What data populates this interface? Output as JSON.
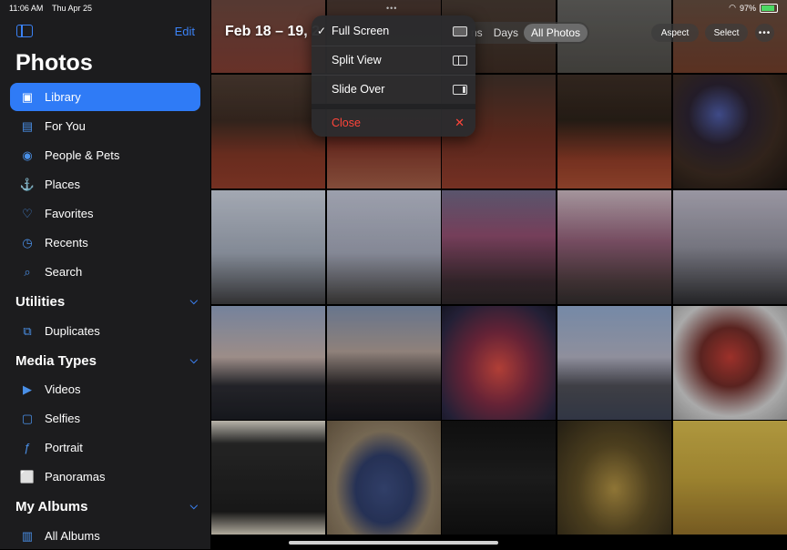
{
  "status": {
    "time": "11:06 AM",
    "date": "Thu Apr 25",
    "battery": "97%"
  },
  "sidebar": {
    "edit": "Edit",
    "title": "Photos",
    "items": [
      {
        "label": "Library",
        "icon": "library-icon",
        "active": true
      },
      {
        "label": "For You",
        "icon": "for-you-icon"
      },
      {
        "label": "People & Pets",
        "icon": "people-icon"
      },
      {
        "label": "Places",
        "icon": "places-icon"
      },
      {
        "label": "Favorites",
        "icon": "heart-icon"
      },
      {
        "label": "Recents",
        "icon": "clock-icon"
      },
      {
        "label": "Search",
        "icon": "search-icon"
      }
    ],
    "utilities": {
      "title": "Utilities",
      "items": [
        {
          "label": "Duplicates",
          "icon": "duplicates-icon"
        }
      ]
    },
    "media_types": {
      "title": "Media Types",
      "items": [
        {
          "label": "Videos",
          "icon": "video-icon"
        },
        {
          "label": "Selfies",
          "icon": "selfie-icon"
        },
        {
          "label": "Portrait",
          "icon": "portrait-icon"
        },
        {
          "label": "Panoramas",
          "icon": "panorama-icon"
        }
      ]
    },
    "my_albums": {
      "title": "My Albums",
      "items": [
        {
          "label": "All Albums",
          "icon": "albums-icon"
        }
      ]
    }
  },
  "header": {
    "date_range": "Feb 18 – 19, 2",
    "segments": [
      "ns",
      "Days",
      "All Photos"
    ],
    "selected_segment": "All Photos",
    "aspect": "Aspect",
    "select": "Select",
    "more": "•••"
  },
  "menu": {
    "items": [
      {
        "label": "Full Screen",
        "checked": true
      },
      {
        "label": "Split View"
      },
      {
        "label": "Slide Over"
      }
    ],
    "close": "Close"
  },
  "colors": {
    "accent": "#2f7bf6",
    "sidebar_bg": "#1c1c1e",
    "destructive": "#ff453a"
  }
}
